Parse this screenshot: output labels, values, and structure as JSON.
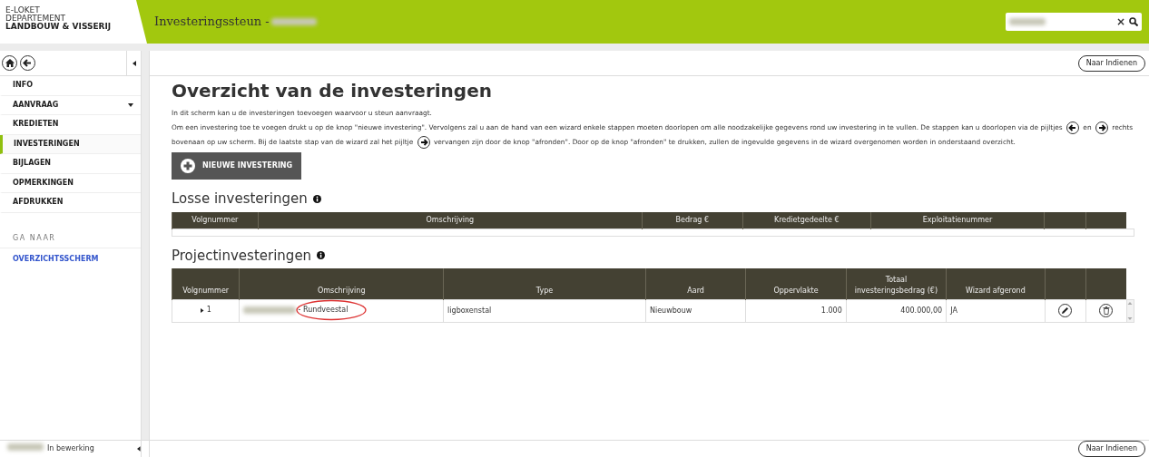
{
  "header": {
    "logo_lines": [
      "E-LOKET",
      "DEPARTEMENT",
      "LANDBOUW & VISSERIJ"
    ],
    "title": "Investeringssteun -",
    "title_redacted": true,
    "search": {
      "redacted": true,
      "clear": "×"
    }
  },
  "sidebar": {
    "items": [
      {
        "label": "INFO",
        "selected": false,
        "expandable": false
      },
      {
        "label": "AANVRAAG",
        "selected": false,
        "expandable": true
      },
      {
        "label": "KREDIETEN",
        "selected": false,
        "expandable": false
      },
      {
        "label": "INVESTERINGEN",
        "selected": true,
        "expandable": false
      },
      {
        "label": "BIJLAGEN",
        "selected": false,
        "expandable": false
      },
      {
        "label": "OPMERKINGEN",
        "selected": false,
        "expandable": false
      },
      {
        "label": "AFDRUKKEN",
        "selected": false,
        "expandable": false
      }
    ],
    "section": "GA NAAR",
    "links": [
      "OVERZICHTSSCHERM"
    ]
  },
  "top_button": "Naar Indienen",
  "heading": "Overzicht van de investeringen",
  "intro_first": "In dit scherm kan u de investeringen toevoegen waarvoor u steun aanvraagt.",
  "intro_lines": [
    [
      {
        "kind": "text",
        "text": "Om een investering toe te voegen drukt u op de knop \"nieuwe investering\". Vervolgens zal u aan de hand van een wizard enkele stappen moeten doorlopen om alle noodzakelijke gegevens rond uw investering in te vullen. De stappen kan u doorlopen via de pijltjes"
      },
      {
        "kind": "left-arrow"
      },
      {
        "kind": "text",
        "text": "en"
      },
      {
        "kind": "right-arrow"
      },
      {
        "kind": "text",
        "text": "rechts"
      }
    ],
    [
      {
        "kind": "text",
        "text": "bovenaan op uw scherm. Bij de laatste stap van de wizard zal het pijltje"
      },
      {
        "kind": "right-arrow"
      },
      {
        "kind": "text",
        "text": "vervangen zijn door de knop \"afronden\". Door op de knop \"afronden\" te drukken, zullen de ingevulde gegevens in de wizard overgenomen worden in onderstaand overzicht."
      }
    ]
  ],
  "add_button": "NIEUWE INVESTERING",
  "losse": {
    "title": "Losse investeringen",
    "columns": [
      "Volgnummer",
      "Omschrijving",
      "Bedrag €",
      "Kredietgedeelte €",
      "Exploitatienummer"
    ]
  },
  "project": {
    "title": "Projectinvesteringen",
    "columns": [
      "Volgnummer",
      "Omschrijving",
      "Type",
      "Aard",
      "Oppervlakte",
      "Totaal investeringsbedrag (€)",
      "Wizard afgerond"
    ],
    "rows": [
      {
        "number": "1",
        "expanded": false,
        "description_redacted": true,
        "description": "- Rundveestal",
        "highlighted": true,
        "type": "ligboxenstal",
        "aard": "Nieuwbouw",
        "oppervlakte": "1.000",
        "totaal": "400.000,00",
        "wizard": "JA"
      }
    ]
  },
  "footer": {
    "status_redacted": true,
    "status": "In bewerking",
    "button": "Naar Indienen"
  }
}
